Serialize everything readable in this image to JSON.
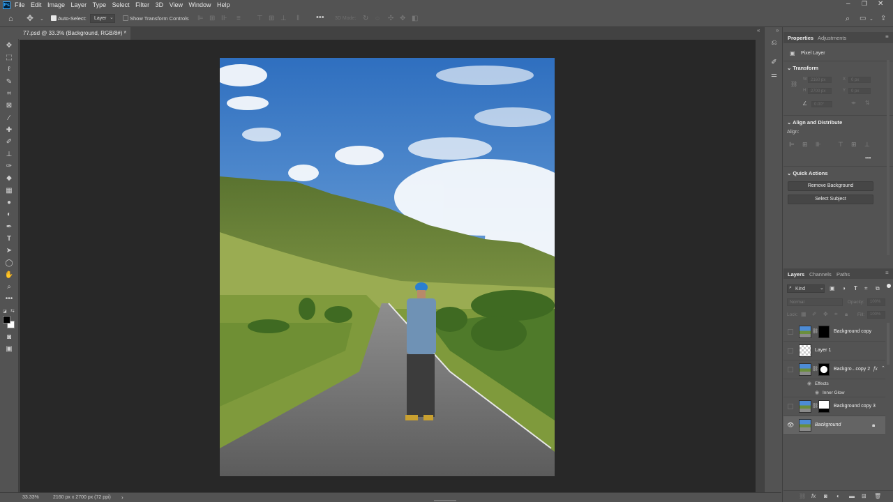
{
  "app": {
    "logo": "Ps"
  },
  "menu": [
    "File",
    "Edit",
    "Image",
    "Layer",
    "Type",
    "Select",
    "Filter",
    "3D",
    "View",
    "Window",
    "Help"
  ],
  "options": {
    "auto_select_label": "Auto-Select:",
    "auto_select_value": "Layer",
    "show_transform_label": "Show Transform Controls",
    "mode_3d_label": "3D Mode:"
  },
  "document": {
    "tab_title": "77.psd @ 33.3% (Background, RGB/8#) *",
    "close": "×"
  },
  "status": {
    "zoom": "33.33%",
    "doc_info": "2160 px x 2700 px (72 ppi)",
    "arrow": "›"
  },
  "properties": {
    "tabs": [
      "Properties",
      "Adjustments"
    ],
    "layer_type": "Pixel Layer",
    "transform": {
      "title": "Transform",
      "w_label": "W",
      "w_value": "2160 px",
      "h_label": "H",
      "h_value": "2700 px",
      "x_label": "X",
      "x_value": "0 px",
      "y_label": "Y",
      "y_value": "0 px",
      "angle_value": "0.00°"
    },
    "align": {
      "title": "Align and Distribute",
      "label": "Align:",
      "more": "•••"
    },
    "quick_actions": {
      "title": "Quick Actions",
      "remove_bg": "Remove Background",
      "select_subject": "Select Subject"
    }
  },
  "layers_panel": {
    "tabs": [
      "Layers",
      "Channels",
      "Paths"
    ],
    "filter_kind": "Kind",
    "blend_mode": "Normal",
    "opacity_label": "Opacity:",
    "opacity_value": "100%",
    "lock_label": "Lock:",
    "fill_label": "Fill:",
    "fill_value": "100%",
    "layers": [
      {
        "name": "Background copy"
      },
      {
        "name": "Layer 1"
      },
      {
        "name": "Backgro...copy 2",
        "fx": "fx"
      },
      {
        "effects": "Effects",
        "inner_glow": "Inner Glow"
      },
      {
        "name": "Background copy 3"
      },
      {
        "name": "Background"
      }
    ]
  },
  "colors": {
    "accent": "#31a8ff",
    "canvas_bg": "#282828",
    "panel_bg": "#535353"
  }
}
